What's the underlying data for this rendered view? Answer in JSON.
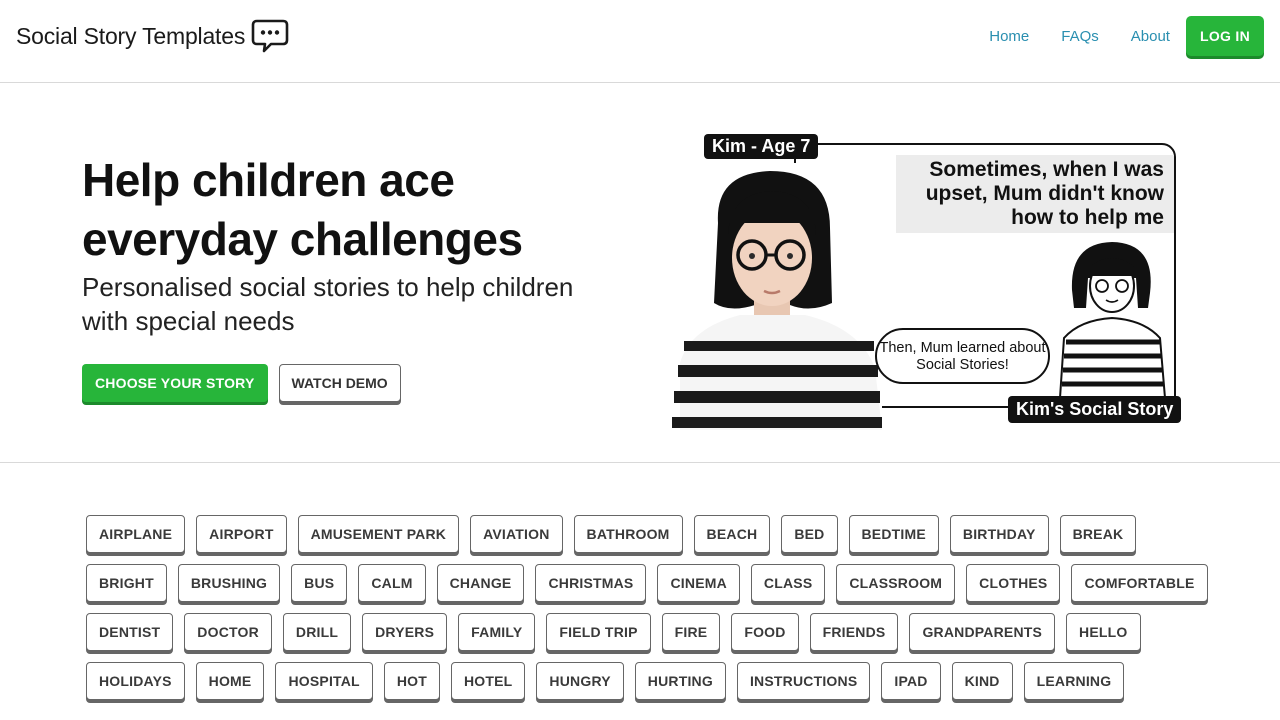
{
  "header": {
    "brand": "Social Story Templates",
    "brand_icon": "speech-bubble-icon",
    "nav": [
      "Home",
      "FAQs",
      "About"
    ],
    "login_label": "LOG IN"
  },
  "hero": {
    "title": "Help children ace everyday challenges",
    "subtitle": "Personalised social stories to help children with special needs",
    "primary_cta": "CHOOSE YOUR STORY",
    "secondary_cta": "WATCH DEMO",
    "art": {
      "name_tag": "Kim - Age 7",
      "speech_top": "Sometimes, when I was upset, Mum didn't know how to help me",
      "speech_bubble": "Then, Mum learned about Social Stories!",
      "story_tag": "Kim's Social Story"
    }
  },
  "tags": [
    [
      "AIRPLANE",
      "AIRPORT",
      "AMUSEMENT PARK",
      "AVIATION",
      "BATHROOM",
      "BEACH",
      "BED",
      "BEDTIME",
      "BIRTHDAY",
      "BREAK"
    ],
    [
      "BRIGHT",
      "BRUSHING",
      "BUS",
      "CALM",
      "CHANGE",
      "CHRISTMAS",
      "CINEMA",
      "CLASS",
      "CLASSROOM",
      "CLOTHES",
      "COMFORTABLE"
    ],
    [
      "DENTIST",
      "DOCTOR",
      "DRILL",
      "DRYERS",
      "FAMILY",
      "FIELD TRIP",
      "FIRE",
      "FOOD",
      "FRIENDS",
      "GRANDPARENTS",
      "HELLO"
    ],
    [
      "HOLIDAYS",
      "HOME",
      "HOSPITAL",
      "HOT",
      "HOTEL",
      "HUNGRY",
      "HURTING",
      "INSTRUCTIONS",
      "IPAD",
      "KIND",
      "LEARNING"
    ]
  ],
  "colors": {
    "accent": "#27b53a",
    "link": "#2a8fb0"
  }
}
